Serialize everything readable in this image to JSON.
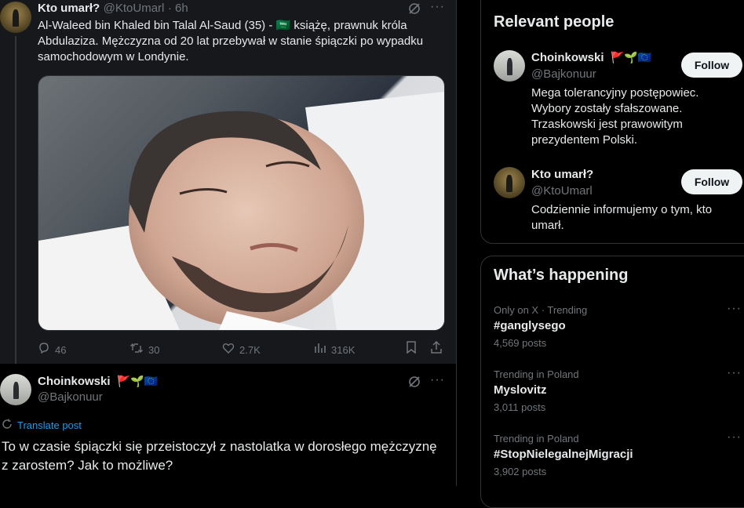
{
  "quoted_post": {
    "author_name": "Kto umarł?",
    "author_handle": "@KtoUmarl",
    "time": "· 6h",
    "text_line1": "Al-Waleed bin Khaled bin Talal Al-Saud (35) -",
    "flag_emoji": "🇸🇦",
    "text_line1_end": "książę, prawnuk króla",
    "text_line2": "Abdulaziza. Mężczyzna od 20 lat przebywał w stanie śpiączki po wypadku",
    "text_line3": "samochodowym w Londynie.",
    "metrics": {
      "replies": "46",
      "reposts": "30",
      "likes": "2.7K",
      "views": "316K"
    }
  },
  "main_post": {
    "author_name": "Choinkowski",
    "author_emojis": "🚩🌱🇪🇺",
    "author_handle": "@Bajkonuur",
    "translate_label": "Translate post",
    "text_line1": "To w czasie śpiączki się przeistoczył z nastolatka w dorosłego mężczyznę",
    "text_line2": "z zarostem? Jak to możliwe?"
  },
  "relevant_people": {
    "title": "Relevant people",
    "people": [
      {
        "name": "Choinkowski",
        "emojis": "🚩🌱🇪🇺",
        "handle": "@Bajkonuur",
        "follow_label": "Follow",
        "bio_lines": [
          "Mega tolerancyjny postępowiec.",
          "Wybory zostały sfałszowane.",
          "Trzaskowski jest prawowitym",
          "prezydentem Polski."
        ]
      },
      {
        "name": "Kto umarł?",
        "handle": "@KtoUmarl",
        "follow_label": "Follow",
        "bio_lines": [
          "Codziennie informujemy o tym, kto",
          "umarł."
        ]
      }
    ]
  },
  "whats_happening": {
    "title": "What’s happening",
    "trends": [
      {
        "meta": "Only on X · Trending",
        "name": "#ganglysego",
        "count": "4,569 posts"
      },
      {
        "meta": "Trending in Poland",
        "name": "Myslovitz",
        "count": "3,011 posts"
      },
      {
        "meta": "Trending in Poland",
        "name": "#StopNielegalnejMigracji",
        "count": "3,902 posts"
      }
    ]
  },
  "colors": {
    "background": "#000000",
    "quoted_background": "#16181c",
    "text": "#e7e9ea",
    "muted": "#71767b",
    "link": "#1d9bf0",
    "border": "#2f3336",
    "follow_bg": "#eff3f4"
  },
  "icons": {
    "reply": "reply-icon",
    "repost": "repost-icon",
    "like": "like-icon",
    "views": "views-icon",
    "bookmark": "bookmark-icon",
    "share": "share-icon",
    "grok": "grok-icon",
    "more": "more-icon",
    "translate": "translate-icon"
  }
}
